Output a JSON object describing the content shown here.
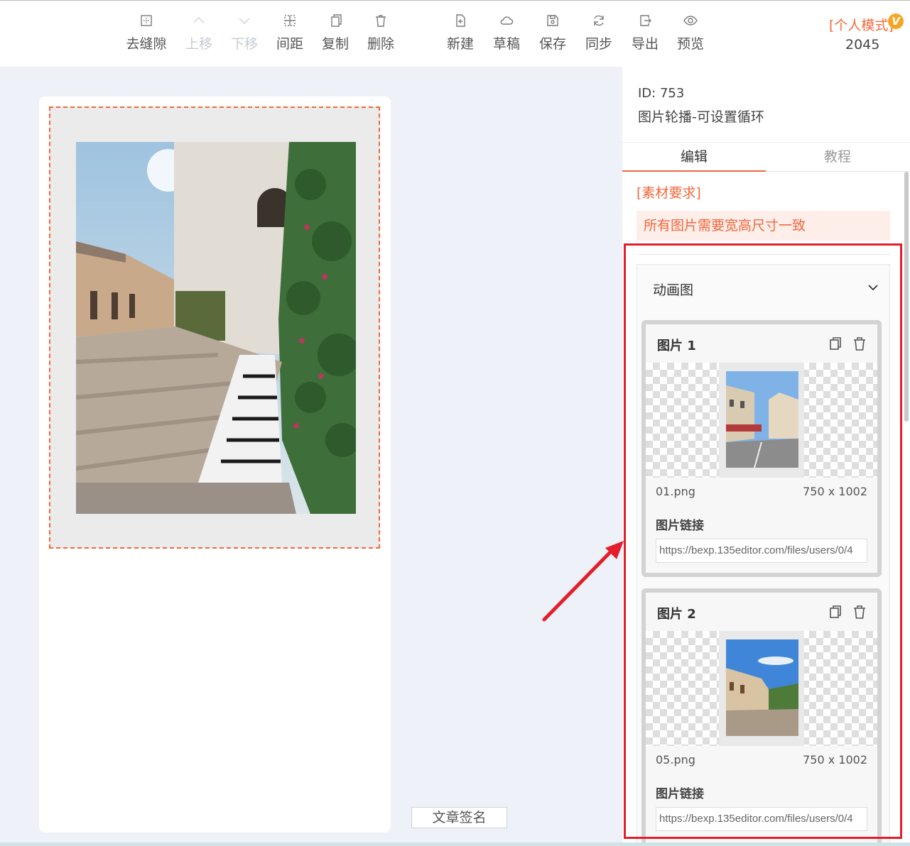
{
  "toolbar": {
    "buttons": [
      {
        "label": "去缝隙",
        "icon": "grid-icon",
        "disabled": false
      },
      {
        "label": "上移",
        "icon": "chevron-up-icon",
        "disabled": true
      },
      {
        "label": "下移",
        "icon": "chevron-down-icon",
        "disabled": true
      },
      {
        "label": "间距",
        "icon": "spacing-icon",
        "disabled": false
      },
      {
        "label": "复制",
        "icon": "copy-icon",
        "disabled": false
      },
      {
        "label": "删除",
        "icon": "trash-icon",
        "disabled": false
      },
      {
        "label": "新建",
        "icon": "new-file-icon",
        "disabled": false
      },
      {
        "label": "草稿",
        "icon": "cloud-icon",
        "disabled": false
      },
      {
        "label": "保存",
        "icon": "save-icon",
        "disabled": false
      },
      {
        "label": "同步",
        "icon": "sync-icon",
        "disabled": false
      },
      {
        "label": "导出",
        "icon": "export-icon",
        "disabled": false
      },
      {
        "label": "预览",
        "icon": "eye-icon",
        "disabled": false
      }
    ],
    "mode_label": "[个人模式]",
    "vip_badge": "V",
    "count": "2045"
  },
  "canvas": {
    "signature_button": "文章签名"
  },
  "panel": {
    "id_text": "ID: 753",
    "template_name": "图片轮播-可设置循环",
    "tabs": [
      {
        "label": "编辑",
        "active": true
      },
      {
        "label": "教程",
        "active": false
      }
    ],
    "requirement_title": "[素材要求]",
    "requirement_text": "所有图片需要宽高尺寸一致",
    "accordion_title": "动画图",
    "items": [
      {
        "title": "图片 1",
        "filename": "01.png",
        "size": "750 x 1002",
        "link_label": "图片链接",
        "link_value": "https://bexp.135editor.com/files/users/0/4"
      },
      {
        "title": "图片 2",
        "filename": "05.png",
        "size": "750 x 1002",
        "link_label": "图片链接",
        "link_value": "https://bexp.135editor.com/files/users/0/4"
      }
    ]
  },
  "colors": {
    "accent": "#f2683d",
    "annotation_red": "#e31e2a",
    "canvas_bg": "#eef1f7"
  }
}
